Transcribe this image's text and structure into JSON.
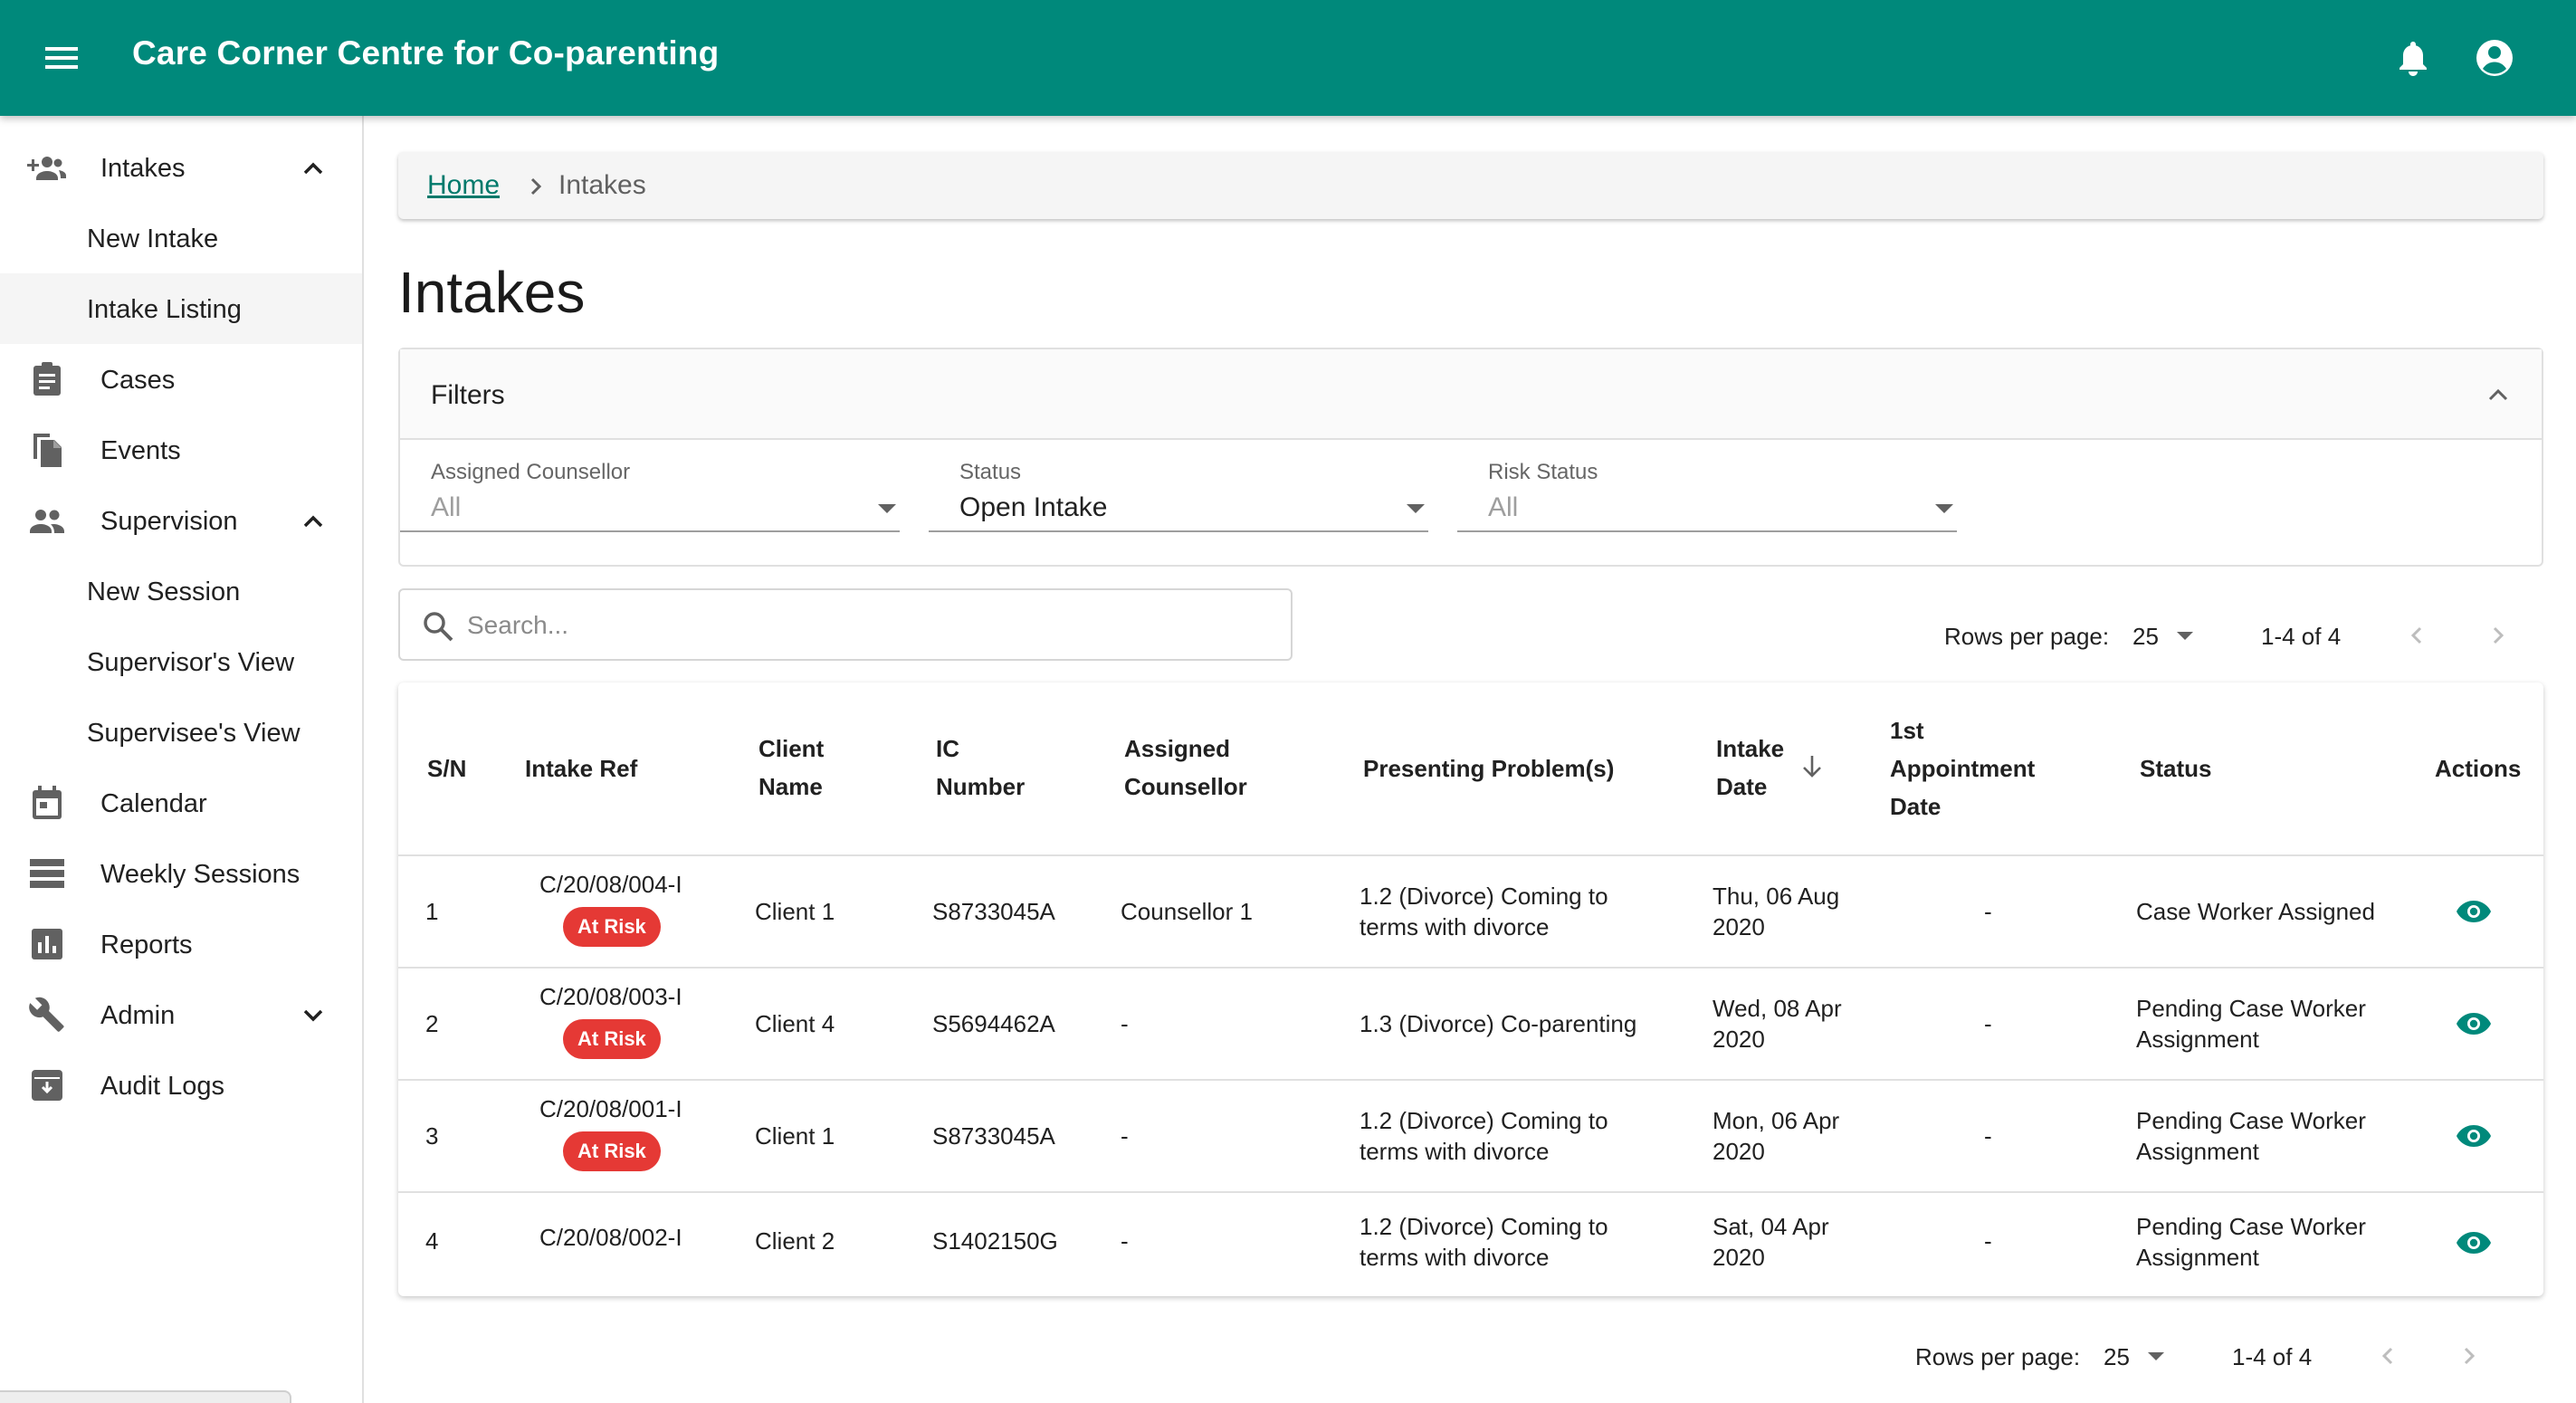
{
  "app": {
    "title": "Care Corner Centre for Co-parenting",
    "accent": "#00897b"
  },
  "sidebar": {
    "items": [
      {
        "label": "Intakes",
        "icon": "group-add-icon",
        "expanded": true
      },
      {
        "label": "New Intake"
      },
      {
        "label": "Intake Listing",
        "active": true
      },
      {
        "label": "Cases",
        "icon": "clipboard-icon"
      },
      {
        "label": "Events",
        "icon": "copy-icon"
      },
      {
        "label": "Supervision",
        "icon": "people-icon",
        "expanded": true
      },
      {
        "label": "New Session"
      },
      {
        "label": "Supervisor's View"
      },
      {
        "label": "Supervisee's View"
      },
      {
        "label": "Calendar",
        "icon": "calendar-icon"
      },
      {
        "label": "Weekly Sessions",
        "icon": "list-icon"
      },
      {
        "label": "Reports",
        "icon": "bar-chart-icon"
      },
      {
        "label": "Admin",
        "icon": "wrench-icon",
        "expanded": false
      },
      {
        "label": "Audit Logs",
        "icon": "archive-icon"
      }
    ]
  },
  "breadcrumb": {
    "home": "Home",
    "current": "Intakes"
  },
  "page": {
    "title": "Intakes"
  },
  "filters": {
    "title": "Filters",
    "fields": [
      {
        "label": "Assigned Counsellor",
        "value": "All"
      },
      {
        "label": "Status",
        "value": "Open Intake"
      },
      {
        "label": "Risk Status",
        "value": "All"
      }
    ]
  },
  "search": {
    "placeholder": "Search..."
  },
  "pagination": {
    "rows_label": "Rows per page:",
    "rows_value": "25",
    "range": "1-4 of 4"
  },
  "table": {
    "headers": {
      "sn": "S/N",
      "ref": "Intake Ref",
      "client_1": "Client",
      "client_2": "Name",
      "ic_1": "IC",
      "ic_2": "Number",
      "counsellor_1": "Assigned",
      "counsellor_2": "Counsellor",
      "problem": "Presenting Problem(s)",
      "date_1": "Intake",
      "date_2": "Date",
      "appt_1": "1st",
      "appt_2": "Appointment",
      "appt_3": "Date",
      "status": "Status",
      "actions": "Actions"
    },
    "rows": [
      {
        "sn": "1",
        "ref": "C/20/08/004-I",
        "risk": "At Risk",
        "client": "Client 1",
        "ic": "S8733045A",
        "counsellor": "Counsellor 1",
        "problem_1": "1.2 (Divorce) Coming to",
        "problem_2": "terms with divorce",
        "date_1": "Thu, 06 Aug",
        "date_2": "2020",
        "appt": "-",
        "status_1": "Case Worker Assigned",
        "status_2": ""
      },
      {
        "sn": "2",
        "ref": "C/20/08/003-I",
        "risk": "At Risk",
        "client": "Client 4",
        "ic": "S5694462A",
        "counsellor": "-",
        "problem_1": "1.3 (Divorce) Co-parenting",
        "problem_2": "",
        "date_1": "Wed, 08 Apr",
        "date_2": "2020",
        "appt": "-",
        "status_1": "Pending Case Worker",
        "status_2": "Assignment"
      },
      {
        "sn": "3",
        "ref": "C/20/08/001-I",
        "risk": "At Risk",
        "client": "Client 1",
        "ic": "S8733045A",
        "counsellor": "-",
        "problem_1": "1.2 (Divorce) Coming to",
        "problem_2": "terms with divorce",
        "date_1": "Mon, 06 Apr",
        "date_2": "2020",
        "appt": "-",
        "status_1": "Pending Case Worker",
        "status_2": "Assignment"
      },
      {
        "sn": "4",
        "ref": "C/20/08/002-I",
        "risk": "",
        "client": "Client 2",
        "ic": "S1402150G",
        "counsellor": "-",
        "problem_1": "1.2 (Divorce) Coming to",
        "problem_2": "terms with divorce",
        "date_1": "Sat, 04 Apr",
        "date_2": "2020",
        "appt": "-",
        "status_1": "Pending Case Worker",
        "status_2": "Assignment"
      }
    ]
  },
  "colors": {
    "risk_badge": "#e53935",
    "action_icon": "#00897b",
    "link": "#00796b"
  }
}
